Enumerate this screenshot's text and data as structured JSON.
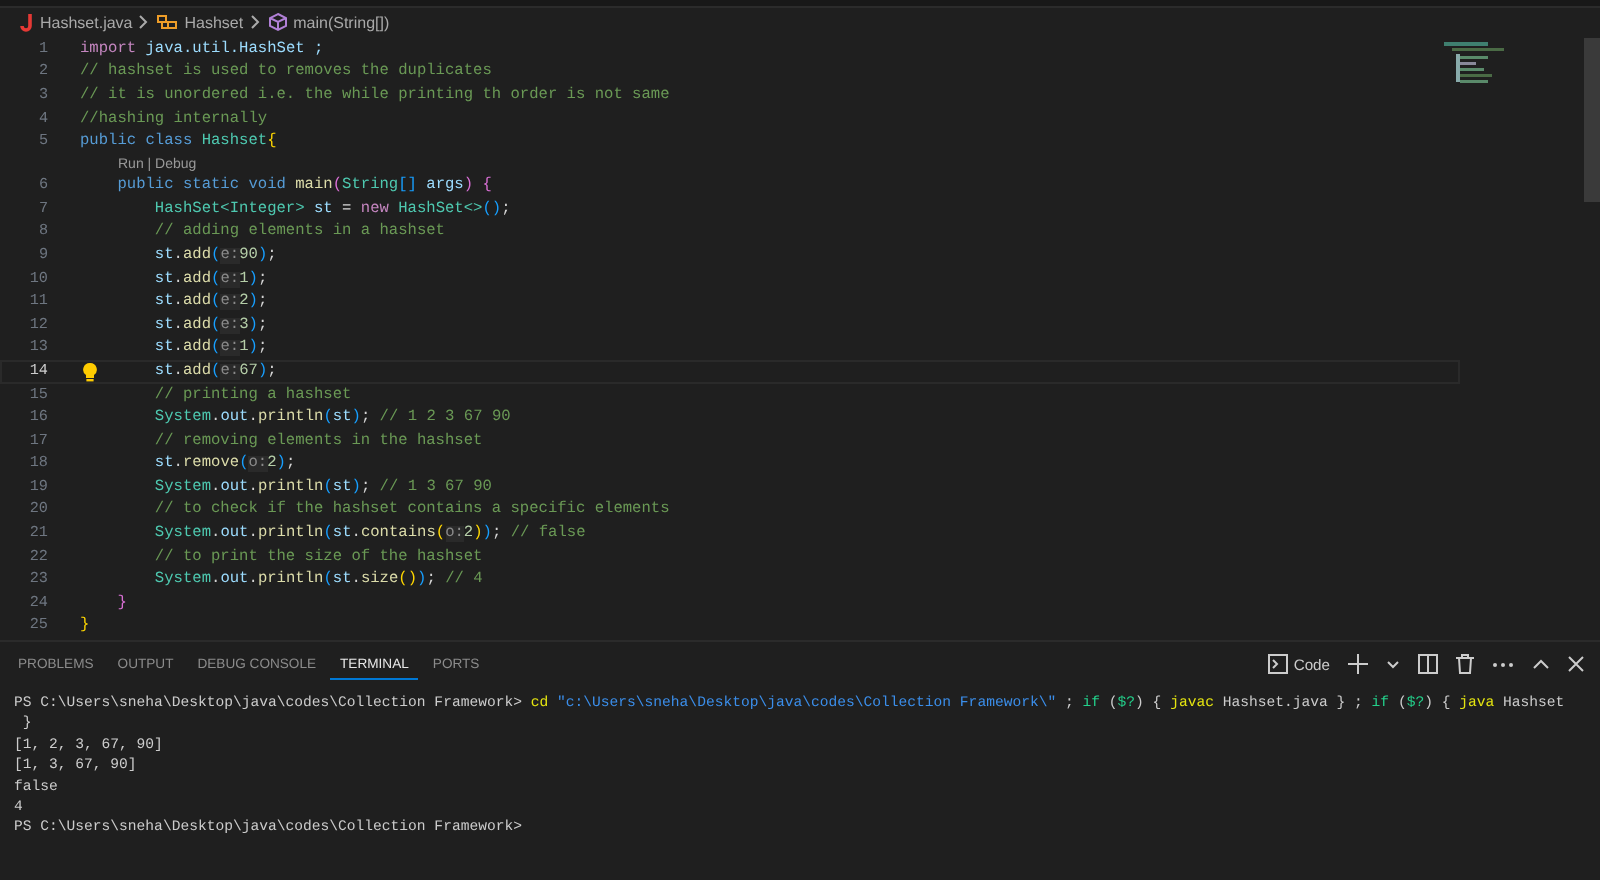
{
  "breadcrumb": [
    {
      "kind": "file",
      "label": "Hashset.java"
    },
    {
      "kind": "class",
      "label": "Hashset"
    },
    {
      "kind": "method",
      "label": "main(String[])"
    }
  ],
  "editor": {
    "lines": [
      {
        "number": "1",
        "current": false,
        "tokens": [
          {
            "kind": "ctrl",
            "text": "import"
          },
          {
            "kind": "var",
            "text": " java.util.HashSet ;"
          }
        ]
      },
      {
        "number": "2",
        "current": false,
        "tokens": [
          {
            "kind": "comment",
            "text": "// hashset is used to removes the duplicates"
          }
        ]
      },
      {
        "number": "3",
        "current": false,
        "tokens": [
          {
            "kind": "comment",
            "text": "// it is unordered i.e. the while printing th order is not same"
          }
        ]
      },
      {
        "number": "4",
        "current": false,
        "tokens": [
          {
            "kind": "comment",
            "text": "//hashing internally"
          }
        ]
      },
      {
        "number": "5",
        "current": false,
        "tokens": [
          {
            "kind": "kw",
            "text": "public class "
          },
          {
            "kind": "type",
            "text": "Hashset"
          },
          {
            "kind": "brace",
            "text": "{"
          }
        ]
      },
      {
        "kind": "codelens",
        "text": "Run | Debug"
      },
      {
        "number": "6",
        "current": false,
        "tokens": [
          {
            "kind": "kw",
            "text": "    public static void "
          },
          {
            "kind": "fn",
            "text": "main"
          },
          {
            "kind": "brace2",
            "text": "("
          },
          {
            "kind": "type",
            "text": "String"
          },
          {
            "kind": "brace3",
            "text": "[]"
          },
          {
            "kind": "var",
            "text": " args"
          },
          {
            "kind": "brace2",
            "text": ") {"
          }
        ]
      },
      {
        "number": "7",
        "current": false,
        "tokens": [
          {
            "kind": "type",
            "text": "        HashSet<Integer>"
          },
          {
            "kind": "var",
            "text": " st"
          },
          {
            "kind": "plain",
            "text": " = "
          },
          {
            "kind": "ctrl",
            "text": "new "
          },
          {
            "kind": "type",
            "text": "HashSet<>"
          },
          {
            "kind": "brace3",
            "text": "()"
          },
          {
            "kind": "plain",
            "text": ";"
          }
        ]
      },
      {
        "number": "8",
        "current": false,
        "tokens": [
          {
            "kind": "comment",
            "text": "        // adding elements in a hashset"
          }
        ]
      },
      {
        "number": "9",
        "current": false,
        "tokens": [
          {
            "kind": "var",
            "text": "        st"
          },
          {
            "kind": "plain",
            "text": "."
          },
          {
            "kind": "fn",
            "text": "add"
          },
          {
            "kind": "brace3",
            "text": "("
          },
          {
            "kind": "hint",
            "text": "e:"
          },
          {
            "kind": "num",
            "text": "90"
          },
          {
            "kind": "brace3",
            "text": ")"
          },
          {
            "kind": "plain",
            "text": ";"
          }
        ]
      },
      {
        "number": "10",
        "current": false,
        "tokens": [
          {
            "kind": "var",
            "text": "        st"
          },
          {
            "kind": "plain",
            "text": "."
          },
          {
            "kind": "fn",
            "text": "add"
          },
          {
            "kind": "brace3",
            "text": "("
          },
          {
            "kind": "hint",
            "text": "e:"
          },
          {
            "kind": "num",
            "text": "1"
          },
          {
            "kind": "brace3",
            "text": ")"
          },
          {
            "kind": "plain",
            "text": ";"
          }
        ]
      },
      {
        "number": "11",
        "current": false,
        "tokens": [
          {
            "kind": "var",
            "text": "        st"
          },
          {
            "kind": "plain",
            "text": "."
          },
          {
            "kind": "fn",
            "text": "add"
          },
          {
            "kind": "brace3",
            "text": "("
          },
          {
            "kind": "hint",
            "text": "e:"
          },
          {
            "kind": "num",
            "text": "2"
          },
          {
            "kind": "brace3",
            "text": ")"
          },
          {
            "kind": "plain",
            "text": ";"
          }
        ]
      },
      {
        "number": "12",
        "current": false,
        "tokens": [
          {
            "kind": "var",
            "text": "        st"
          },
          {
            "kind": "plain",
            "text": "."
          },
          {
            "kind": "fn",
            "text": "add"
          },
          {
            "kind": "brace3",
            "text": "("
          },
          {
            "kind": "hint",
            "text": "e:"
          },
          {
            "kind": "num",
            "text": "3"
          },
          {
            "kind": "brace3",
            "text": ")"
          },
          {
            "kind": "plain",
            "text": ";"
          }
        ]
      },
      {
        "number": "13",
        "current": false,
        "tokens": [
          {
            "kind": "var",
            "text": "        st"
          },
          {
            "kind": "plain",
            "text": "."
          },
          {
            "kind": "fn",
            "text": "add"
          },
          {
            "kind": "brace3",
            "text": "("
          },
          {
            "kind": "hint",
            "text": "e:"
          },
          {
            "kind": "num",
            "text": "1"
          },
          {
            "kind": "brace3",
            "text": ")"
          },
          {
            "kind": "plain",
            "text": ";"
          }
        ]
      },
      {
        "number": "14",
        "current": true,
        "tokens": [
          {
            "kind": "var",
            "text": "        st"
          },
          {
            "kind": "plain",
            "text": "."
          },
          {
            "kind": "fn",
            "text": "add"
          },
          {
            "kind": "brace3",
            "text": "("
          },
          {
            "kind": "hint",
            "text": "e:"
          },
          {
            "kind": "num",
            "text": "67"
          },
          {
            "kind": "brace3",
            "text": ")"
          },
          {
            "kind": "plain",
            "text": ";"
          }
        ]
      },
      {
        "number": "15",
        "current": false,
        "tokens": [
          {
            "kind": "comment",
            "text": "        // printing a hashset"
          }
        ]
      },
      {
        "number": "16",
        "current": false,
        "tokens": [
          {
            "kind": "type",
            "text": "        System"
          },
          {
            "kind": "plain",
            "text": "."
          },
          {
            "kind": "var",
            "text": "out"
          },
          {
            "kind": "plain",
            "text": "."
          },
          {
            "kind": "fn",
            "text": "println"
          },
          {
            "kind": "brace3",
            "text": "("
          },
          {
            "kind": "var",
            "text": "st"
          },
          {
            "kind": "brace3",
            "text": ")"
          },
          {
            "kind": "plain",
            "text": "; "
          },
          {
            "kind": "comment",
            "text": "// 1 2 3 67 90"
          }
        ]
      },
      {
        "number": "17",
        "current": false,
        "tokens": [
          {
            "kind": "comment",
            "text": "        // removing elements in the hashset"
          }
        ]
      },
      {
        "number": "18",
        "current": false,
        "tokens": [
          {
            "kind": "var",
            "text": "        st"
          },
          {
            "kind": "plain",
            "text": "."
          },
          {
            "kind": "fn",
            "text": "remove"
          },
          {
            "kind": "brace3",
            "text": "("
          },
          {
            "kind": "hint",
            "text": "o:"
          },
          {
            "kind": "num",
            "text": "2"
          },
          {
            "kind": "brace3",
            "text": ")"
          },
          {
            "kind": "plain",
            "text": ";"
          }
        ]
      },
      {
        "number": "19",
        "current": false,
        "tokens": [
          {
            "kind": "type",
            "text": "        System"
          },
          {
            "kind": "plain",
            "text": "."
          },
          {
            "kind": "var",
            "text": "out"
          },
          {
            "kind": "plain",
            "text": "."
          },
          {
            "kind": "fn",
            "text": "println"
          },
          {
            "kind": "brace3",
            "text": "("
          },
          {
            "kind": "var",
            "text": "st"
          },
          {
            "kind": "brace3",
            "text": ")"
          },
          {
            "kind": "plain",
            "text": "; "
          },
          {
            "kind": "comment",
            "text": "// 1 3 67 90"
          }
        ]
      },
      {
        "number": "20",
        "current": false,
        "tokens": [
          {
            "kind": "comment",
            "text": "        // to check if the hashset contains a specific elements"
          }
        ]
      },
      {
        "number": "21",
        "current": false,
        "tokens": [
          {
            "kind": "type",
            "text": "        System"
          },
          {
            "kind": "plain",
            "text": "."
          },
          {
            "kind": "var",
            "text": "out"
          },
          {
            "kind": "plain",
            "text": "."
          },
          {
            "kind": "fn",
            "text": "println"
          },
          {
            "kind": "brace3",
            "text": "("
          },
          {
            "kind": "var",
            "text": "st"
          },
          {
            "kind": "plain",
            "text": "."
          },
          {
            "kind": "fn",
            "text": "contains"
          },
          {
            "kind": "brace",
            "text": "("
          },
          {
            "kind": "hint",
            "text": "o:"
          },
          {
            "kind": "num",
            "text": "2"
          },
          {
            "kind": "brace",
            "text": ")"
          },
          {
            "kind": "brace3",
            "text": ")"
          },
          {
            "kind": "plain",
            "text": "; "
          },
          {
            "kind": "comment",
            "text": "// false"
          }
        ]
      },
      {
        "number": "22",
        "current": false,
        "tokens": [
          {
            "kind": "comment",
            "text": "        // to print the size of the hashset"
          }
        ]
      },
      {
        "number": "23",
        "current": false,
        "tokens": [
          {
            "kind": "type",
            "text": "        System"
          },
          {
            "kind": "plain",
            "text": "."
          },
          {
            "kind": "var",
            "text": "out"
          },
          {
            "kind": "plain",
            "text": "."
          },
          {
            "kind": "fn",
            "text": "println"
          },
          {
            "kind": "brace3",
            "text": "("
          },
          {
            "kind": "var",
            "text": "st"
          },
          {
            "kind": "plain",
            "text": "."
          },
          {
            "kind": "fn",
            "text": "size"
          },
          {
            "kind": "brace",
            "text": "()"
          },
          {
            "kind": "brace3",
            "text": ")"
          },
          {
            "kind": "plain",
            "text": "; "
          },
          {
            "kind": "comment",
            "text": "// 4"
          }
        ]
      },
      {
        "number": "24",
        "current": false,
        "tokens": [
          {
            "kind": "brace2",
            "text": "    }"
          }
        ]
      },
      {
        "number": "25",
        "current": false,
        "tokens": [
          {
            "kind": "brace",
            "text": "}"
          }
        ]
      }
    ]
  },
  "panel": {
    "tabs": [
      {
        "label": "PROBLEMS",
        "selected": false
      },
      {
        "label": "OUTPUT",
        "selected": false
      },
      {
        "label": "DEBUG CONSOLE",
        "selected": false
      },
      {
        "label": "TERMINAL",
        "selected": true
      },
      {
        "label": "PORTS",
        "selected": false
      }
    ],
    "terminal_name": "Code",
    "terminal": [
      {
        "tokens": [
          {
            "kind": "plain",
            "text": "PS C:\\Users\\sneha\\Desktop\\java\\codes\\Collection Framework> "
          },
          {
            "kind": "cmd",
            "text": "cd"
          },
          {
            "kind": "str",
            "text": " \"c:\\Users\\sneha\\Desktop\\java\\codes\\Collection Framework\\\""
          },
          {
            "kind": "plain",
            "text": " ; "
          },
          {
            "kind": "kw",
            "text": "if"
          },
          {
            "kind": "plain",
            "text": " ("
          },
          {
            "kind": "kw",
            "text": "$?"
          },
          {
            "kind": "plain",
            "text": ") { "
          },
          {
            "kind": "cmd",
            "text": "javac"
          },
          {
            "kind": "plain",
            "text": " Hashset.java } ; "
          },
          {
            "kind": "kw",
            "text": "if"
          },
          {
            "kind": "plain",
            "text": " ("
          },
          {
            "kind": "kw",
            "text": "$?"
          },
          {
            "kind": "plain",
            "text": ") { "
          },
          {
            "kind": "cmd",
            "text": "java"
          },
          {
            "kind": "plain",
            "text": " Hashset"
          }
        ]
      },
      {
        "tokens": [
          {
            "kind": "plain",
            "text": " }"
          }
        ]
      },
      {
        "tokens": [
          {
            "kind": "plain",
            "text": "[1, 2, 3, 67, 90]"
          }
        ]
      },
      {
        "tokens": [
          {
            "kind": "plain",
            "text": "[1, 3, 67, 90]"
          }
        ]
      },
      {
        "tokens": [
          {
            "kind": "plain",
            "text": "false"
          }
        ]
      },
      {
        "tokens": [
          {
            "kind": "plain",
            "text": "4"
          }
        ]
      },
      {
        "tokens": [
          {
            "kind": "plain",
            "text": "PS C:\\Users\\sneha\\Desktop\\java\\codes\\Collection Framework>"
          }
        ]
      }
    ]
  }
}
